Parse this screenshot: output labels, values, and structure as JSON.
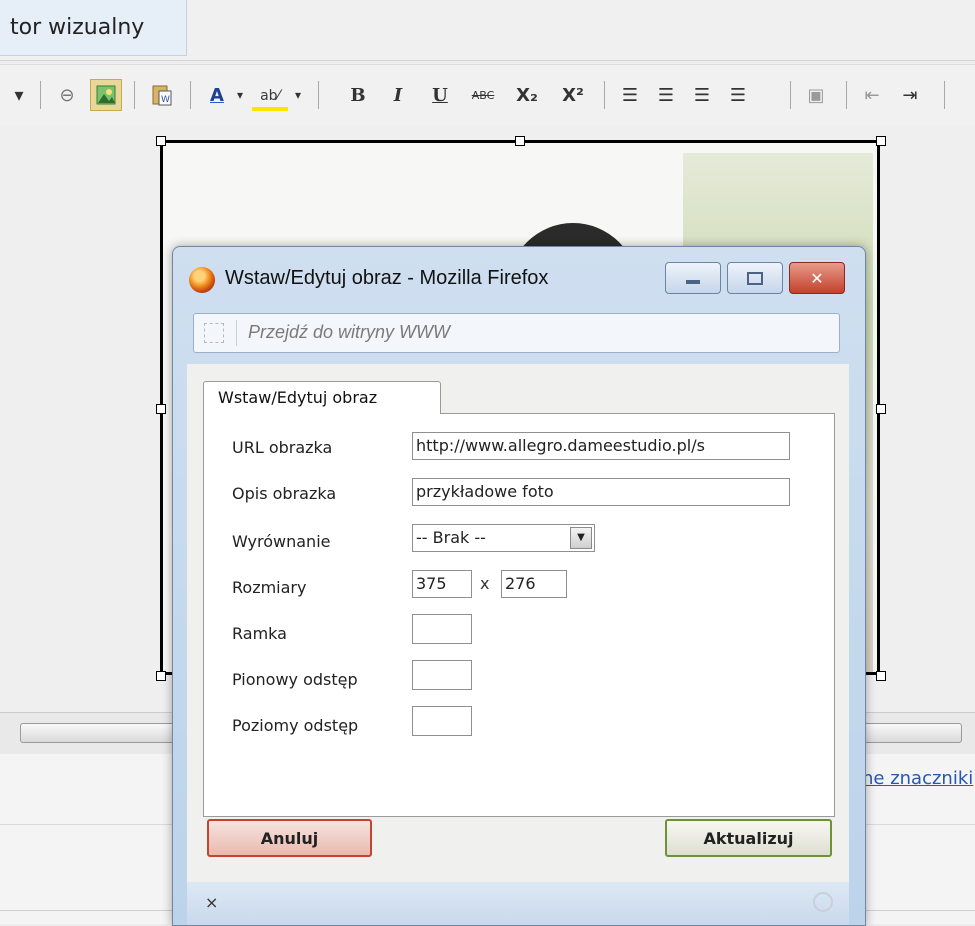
{
  "editor": {
    "tab_label": "tor wizualny",
    "link_text": "ne znaczniki"
  },
  "toolbar": {
    "icons": [
      "dropdown-arrow-icon",
      "link-icon",
      "image-icon",
      "paste-word-icon",
      "font-color-icon",
      "highlight-color-icon",
      "bold-icon",
      "italic-icon",
      "underline-icon",
      "strikethrough-icon",
      "subscript-icon",
      "superscript-icon",
      "align-left-icon",
      "align-center-icon",
      "align-right-icon",
      "justify-icon",
      "insert-icon",
      "outdent-icon",
      "indent-icon"
    ],
    "bold": "B",
    "italic": "I",
    "underline": "U",
    "strike": "ABC",
    "subscript": "X₂",
    "superscript": "X²"
  },
  "dialog": {
    "title": "Wstaw/Edytuj obraz - Mozilla Firefox",
    "address_placeholder": "Przejdź do witryny WWW",
    "tab": "Wstaw/Edytuj obraz",
    "fields": {
      "url_label": "URL obrazka",
      "url_value": "http://www.allegro.dameestudio.pl/s",
      "desc_label": "Opis obrazka",
      "desc_value": "przykładowe foto",
      "align_label": "Wyrównanie",
      "align_value": "-- Brak --",
      "size_label": "Rozmiary",
      "width_value": "375",
      "size_sep": "x",
      "height_value": "276",
      "border_label": "Ramka",
      "vspace_label": "Pionowy odstęp",
      "hspace_label": "Poziomy odstęp"
    },
    "cancel": "Anuluj",
    "update": "Aktualizuj",
    "status_x": "×"
  }
}
